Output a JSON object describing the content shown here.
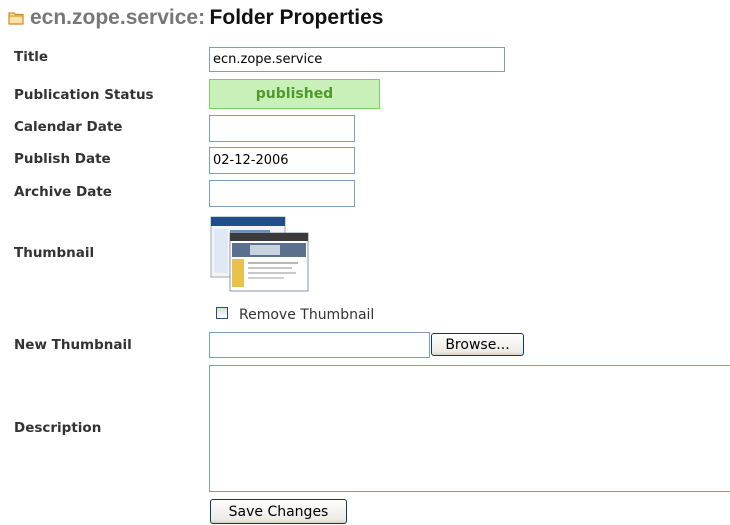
{
  "header": {
    "site_name": "ecn.zope.service:",
    "page_title": "Folder Properties"
  },
  "form": {
    "title": {
      "label": "Title",
      "value": "ecn.zope.service"
    },
    "publication_status": {
      "label": "Publication Status",
      "value": "published"
    },
    "calendar_date": {
      "label": "Calendar Date",
      "value": ""
    },
    "publish_date": {
      "label": "Publish Date",
      "value": "02-12-2006"
    },
    "archive_date": {
      "label": "Archive Date",
      "value": ""
    },
    "thumbnail": {
      "label": "Thumbnail",
      "remove_label": "Remove Thumbnail"
    },
    "new_thumbnail": {
      "label": "New Thumbnail",
      "value": "",
      "browse_label": "Browse..."
    },
    "description": {
      "label": "Description",
      "value": ""
    },
    "save_label": "Save Changes"
  },
  "colors": {
    "status_bg": "#c8f0b8",
    "status_text": "#4e9a2c",
    "folder_icon": "#e6a53a"
  }
}
